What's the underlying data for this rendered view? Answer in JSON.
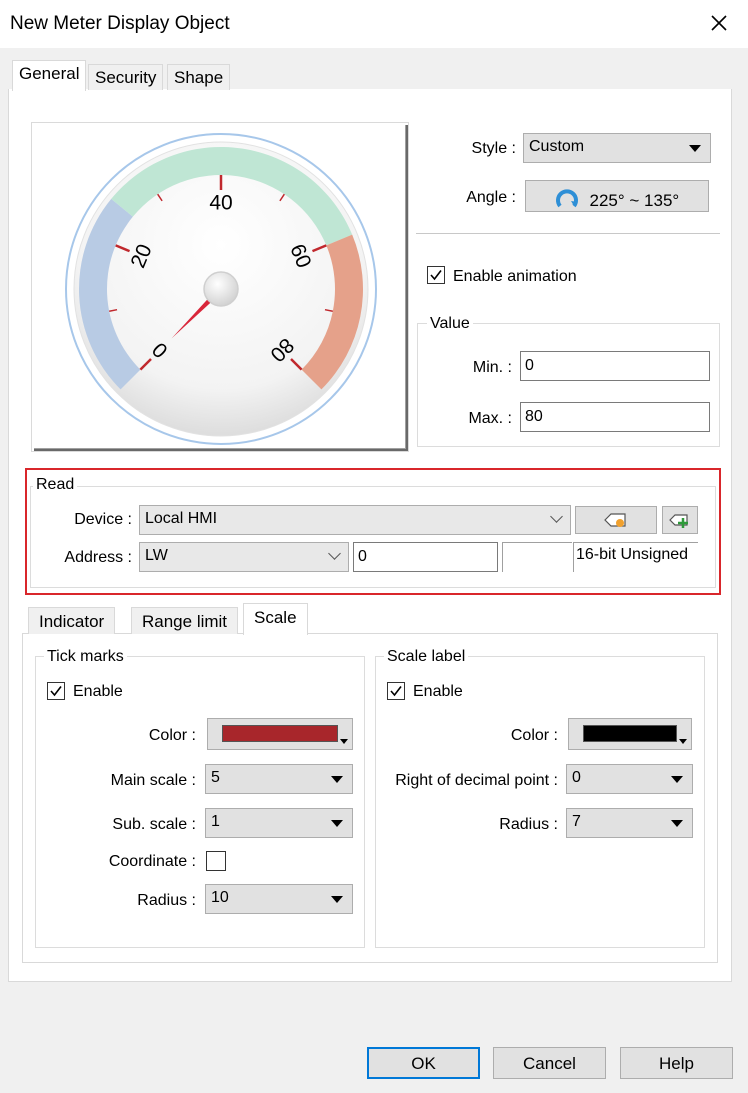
{
  "window": {
    "title": "New Meter Display Object"
  },
  "tabs": [
    {
      "label": "General",
      "active": true
    },
    {
      "label": "Security",
      "active": false
    },
    {
      "label": "Shape",
      "active": false
    }
  ],
  "meter_preview": {
    "ticks": [
      "0",
      "20",
      "40",
      "60",
      "80"
    ],
    "value": 0,
    "min": 0,
    "max": 80,
    "zones": [
      {
        "from": 0,
        "to": 25,
        "color": "#b8cbe4"
      },
      {
        "from": 25,
        "to": 60,
        "color": "#bfe6d4"
      },
      {
        "from": 60,
        "to": 80,
        "color": "#e5a18a"
      }
    ],
    "tick_color": "#c0282d",
    "needle_color": "#d9263a"
  },
  "style": {
    "label": "Style :",
    "value": "Custom"
  },
  "angle": {
    "label": "Angle :",
    "value": "225° ~ 135°",
    "icon": "rotation-arc-icon"
  },
  "animation": {
    "label": "Enable animation",
    "checked": true
  },
  "value_group": {
    "title": "Value",
    "min_label": "Min. :",
    "min_value": "0",
    "max_label": "Max. :",
    "max_value": "80"
  },
  "read": {
    "title": "Read",
    "device_label": "Device :",
    "device_value": "Local HMI",
    "address_label": "Address :",
    "address_type": "LW",
    "address_value": "0",
    "data_format": "16-bit Unsigned",
    "highlight_color": "#d9262b"
  },
  "subtabs": [
    {
      "label": "Indicator",
      "active": false
    },
    {
      "label": "Range limit",
      "active": false
    },
    {
      "label": "Scale",
      "active": true
    }
  ],
  "tick_marks": {
    "title": "Tick marks",
    "enable_label": "Enable",
    "enabled": true,
    "color_label": "Color :",
    "color": "#a8262b",
    "main_scale_label": "Main scale :",
    "main_scale": "5",
    "sub_scale_label": "Sub. scale :",
    "sub_scale": "1",
    "coordinate_label": "Coordinate :",
    "coordinate": false,
    "radius_label": "Radius :",
    "radius": "10"
  },
  "scale_label": {
    "title": "Scale label",
    "enable_label": "Enable",
    "enabled": true,
    "color_label": "Color :",
    "color": "#000000",
    "decimal_label": "Right of decimal point :",
    "decimal": "0",
    "radius_label": "Radius :",
    "radius": "7"
  },
  "buttons": {
    "ok": "OK",
    "cancel": "Cancel",
    "help": "Help"
  }
}
